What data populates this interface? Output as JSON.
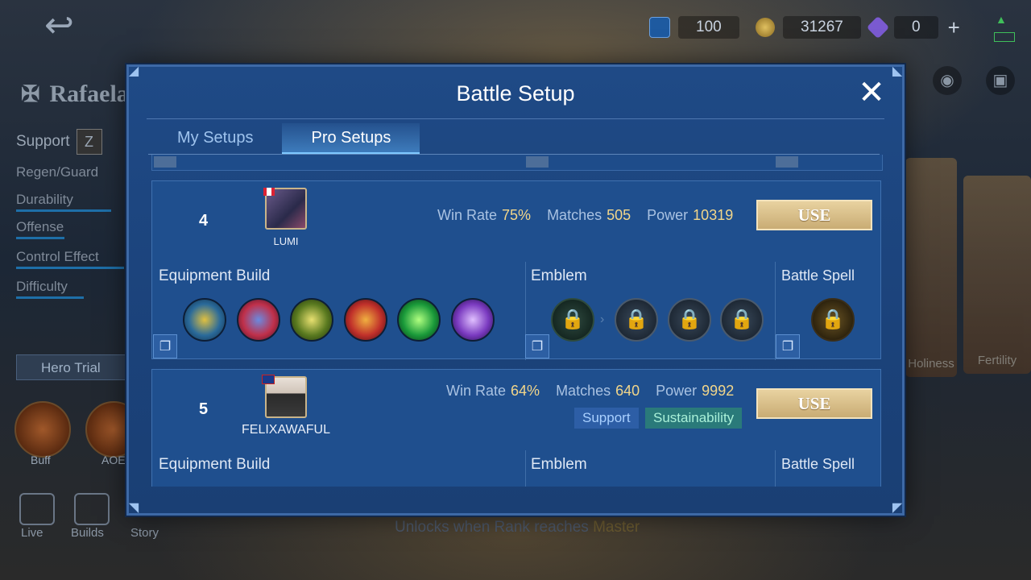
{
  "background": {
    "resources": [
      {
        "icon": "ticket-icon",
        "value": "100"
      },
      {
        "icon": "gold-coin-icon",
        "value": "31267"
      },
      {
        "icon": "diamond-icon",
        "value": "0"
      }
    ],
    "hero_name": "Rafaela",
    "role": "Support",
    "stats": [
      "Regen/Guard",
      "Durability",
      "Offense",
      "Control Effect",
      "Difficulty"
    ],
    "hero_trial_label": "Hero Trial",
    "skills": [
      "Buff",
      "AOE"
    ],
    "bottom_nav": [
      "Live",
      "Builds",
      "Story"
    ],
    "rank_hint_prefix": "Unlocks when Rank reaches",
    "rank_hint_rank": "Master",
    "skin_labels": [
      "Holiness",
      "Fertility"
    ]
  },
  "modal": {
    "title": "Battle Setup",
    "tabs": [
      {
        "label": "My Setups",
        "active": false
      },
      {
        "label": "Pro Setups",
        "active": true
      }
    ],
    "labels": {
      "win_rate": "Win Rate",
      "matches": "Matches",
      "power": "Power",
      "use": "USE",
      "equipment": "Equipment Build",
      "emblem": "Emblem",
      "spell": "Battle Spell"
    },
    "setups": [
      {
        "rank": "4",
        "player": "LUMI",
        "flag": "canada-flag-icon",
        "win_rate": "75%",
        "matches": "505",
        "power": "10319",
        "tags": [],
        "items": [
          "boots-item-icon",
          "blue-tome-item-icon",
          "gold-staff-item-icon",
          "fire-wing-item-icon",
          "green-crystal-item-icon",
          "purple-claw-item-icon"
        ],
        "emblems": [
          "support-emblem-icon",
          "talent-icon",
          "talent-icon",
          "talent-icon"
        ],
        "spell": "flameshot-spell-icon"
      },
      {
        "rank": "5",
        "player": "FELIXAWAFUL",
        "flag": "uk-flag-icon",
        "win_rate": "64%",
        "matches": "640",
        "power": "9992",
        "tags": [
          "Support",
          "Sustainability"
        ]
      }
    ]
  },
  "colors": {
    "modal_bg": "#1f4a86",
    "use_button": "#d9bf88",
    "value_gold": "#f2d68a",
    "tag_support": "#2d5ea6",
    "tag_sustain": "#2a7a7a"
  }
}
